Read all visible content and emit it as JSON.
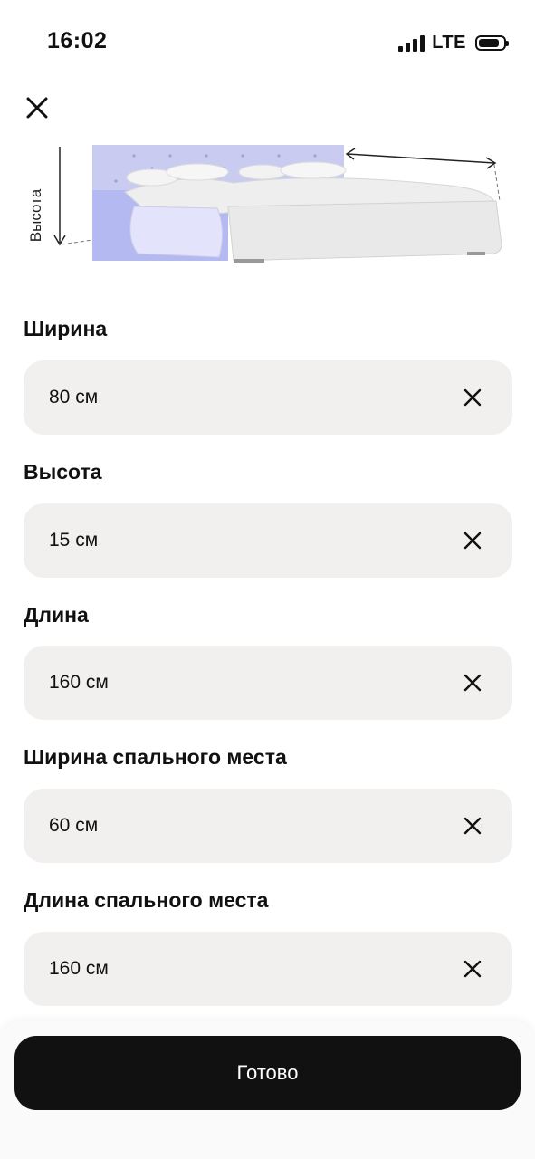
{
  "status_bar": {
    "time": "16:02",
    "carrier": "LTE"
  },
  "illustration": {
    "height_label": "Высота"
  },
  "fields": [
    {
      "label": "Ширина",
      "value": "80 см"
    },
    {
      "label": "Высота",
      "value": "15 см"
    },
    {
      "label": "Длина",
      "value": "160 см"
    },
    {
      "label": "Ширина спального места",
      "value": "60 см"
    },
    {
      "label": "Длина спального места",
      "value": "160 см"
    }
  ],
  "actions": {
    "done_label": "Готово"
  },
  "icons": {
    "close": "close-icon",
    "clear": "clear-icon"
  },
  "colors": {
    "field_background": "#f1f0ee",
    "button_background": "#111111",
    "button_text": "#ffffff",
    "bed_highlight": "#b4b9f2"
  }
}
